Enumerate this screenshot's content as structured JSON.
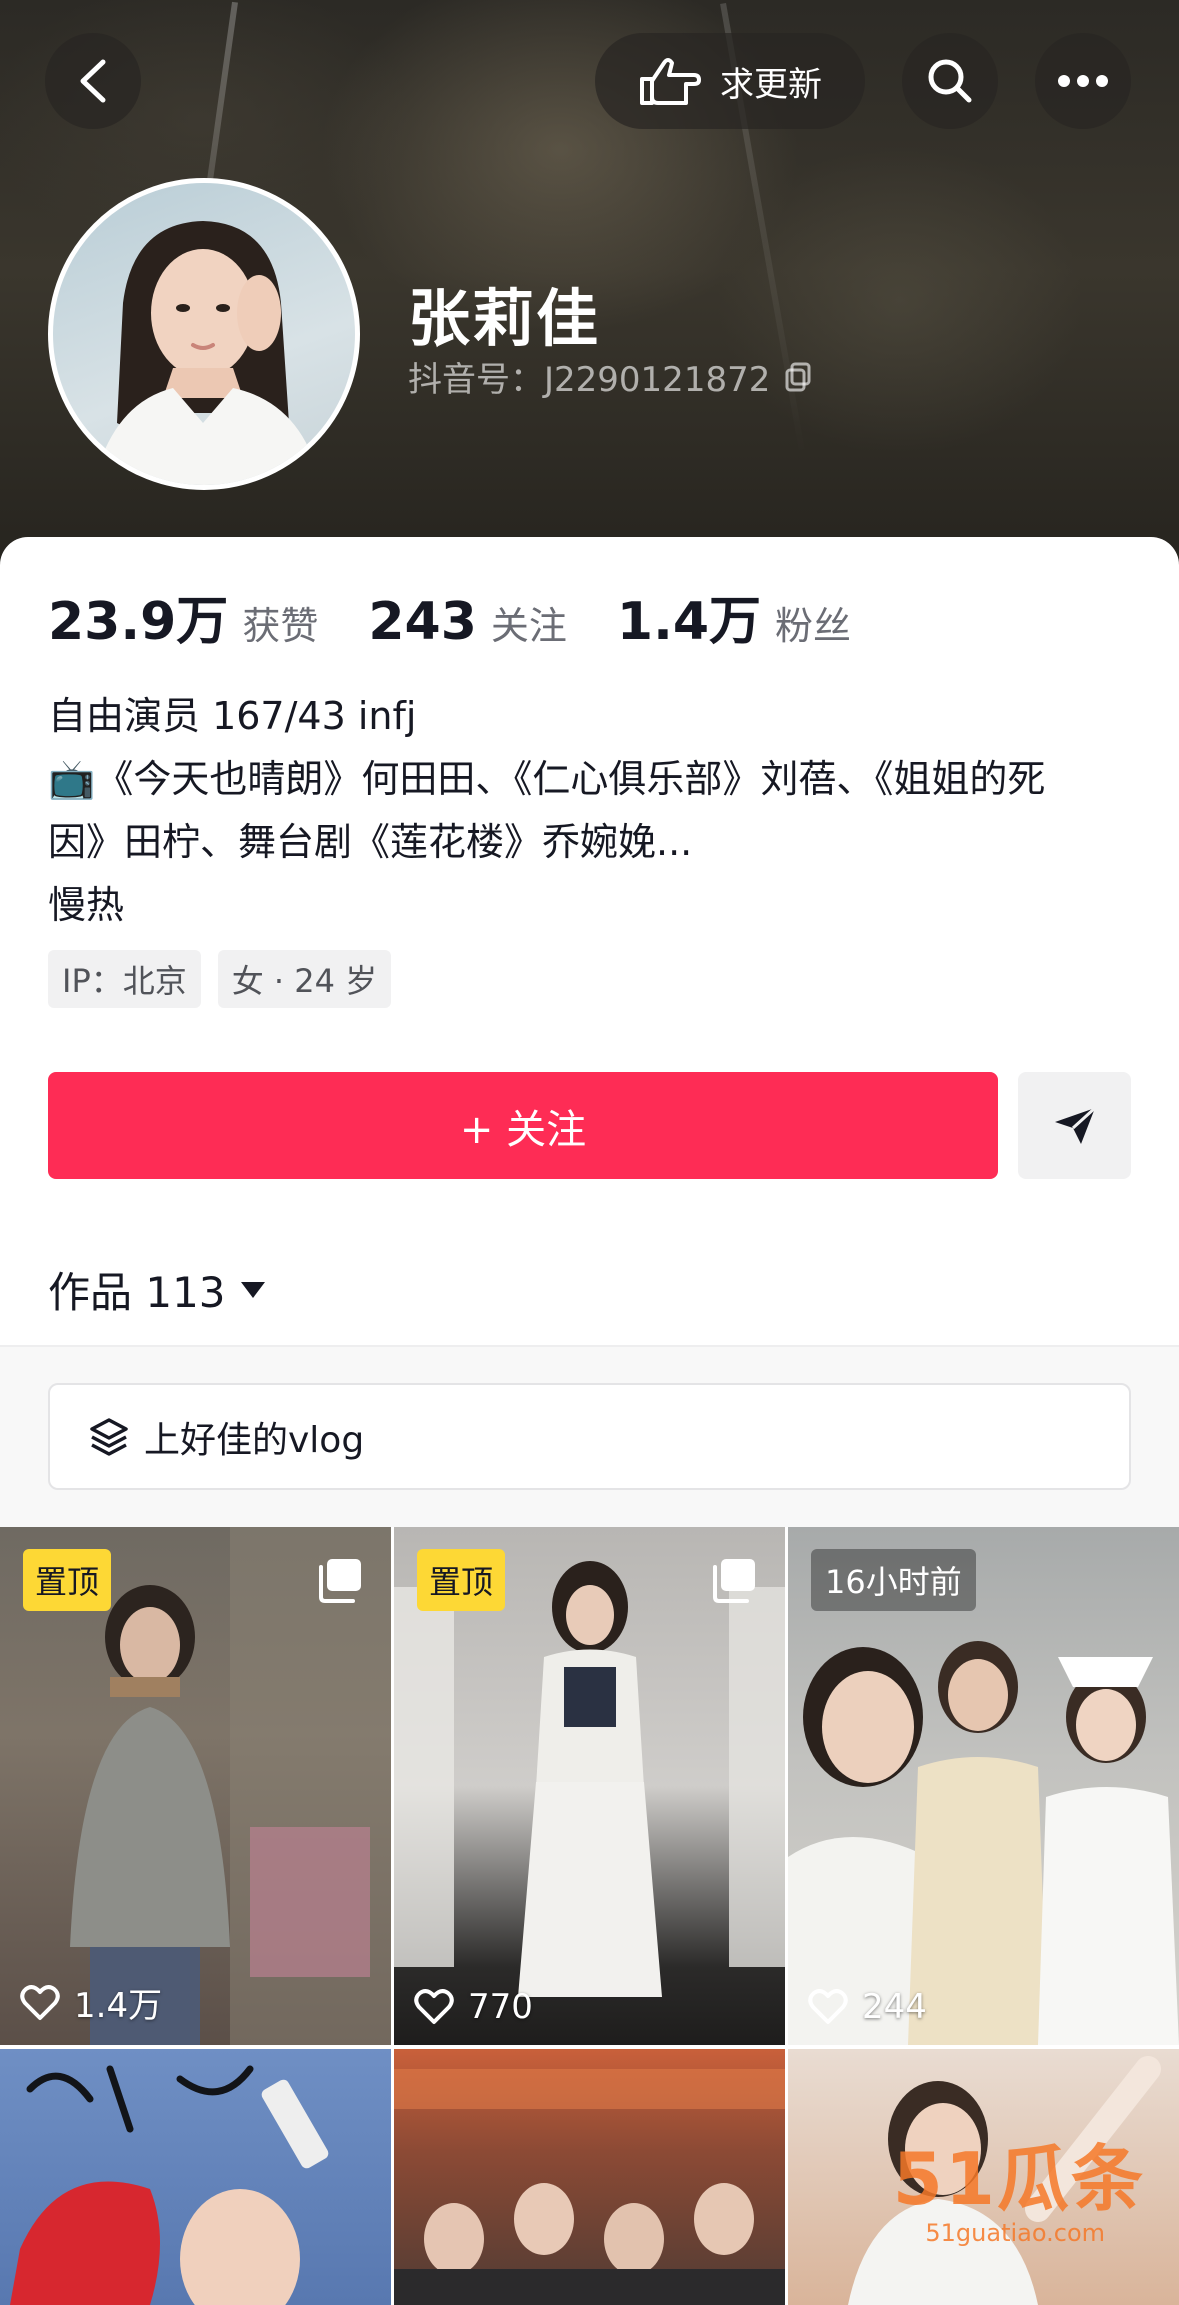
{
  "header": {
    "update_request_label": "求更新",
    "name": "张莉佳",
    "douyin_id": "抖音号：J2290121872"
  },
  "stats": [
    {
      "value": "23.9万",
      "label": "获赞"
    },
    {
      "value": "243",
      "label": "关注"
    },
    {
      "value": "1.4万",
      "label": "粉丝"
    }
  ],
  "bio": {
    "line1": "自由演员 167/43 infj",
    "line2": "📺《今天也晴朗》何田田、《仁心俱乐部》刘蓓、《姐姐的死",
    "line3": "因》田柠、舞台剧《莲花楼》乔婉娩...",
    "line4": "慢热"
  },
  "tags": [
    "IP：北京",
    "女 · 24 岁"
  ],
  "actions": {
    "follow_label": "+ 关注"
  },
  "works": {
    "label": "作品 113",
    "collection_label": "上好佳的vlog"
  },
  "videos": [
    {
      "badge": "置顶",
      "likes": "1.4万",
      "multi": true
    },
    {
      "badge": "置顶",
      "likes": "770",
      "multi": true
    },
    {
      "badge": "16小时前",
      "likes": "244",
      "multi": false
    }
  ],
  "watermark": {
    "brand": "51瓜条",
    "url": "51guatiao.com"
  },
  "colors": {
    "accent": "#fe2c55",
    "pin_badge": "#fdd835"
  }
}
